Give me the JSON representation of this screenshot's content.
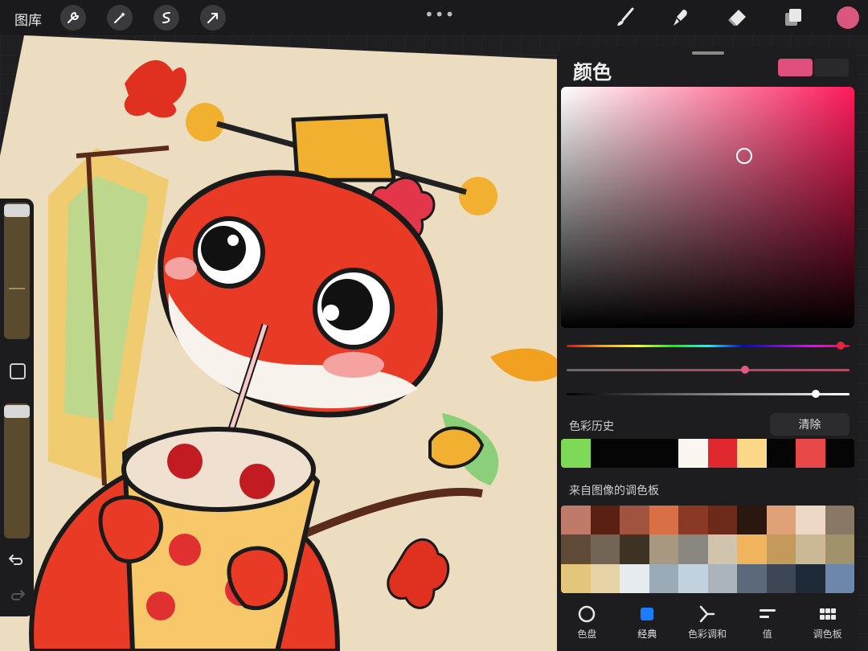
{
  "topbar": {
    "gallery_label": "图库",
    "tools_left": [
      "wrench-icon",
      "magic-wand-icon",
      "selection-icon",
      "transform-arrow-icon"
    ],
    "tools_right": [
      "brush-icon",
      "smudge-icon",
      "eraser-icon",
      "layers-icon"
    ],
    "active_color": "#d9577e"
  },
  "sidebar": {
    "size_slider_value": 0.95,
    "opacity_slider_value": 0.98,
    "modify_button": "square-icon",
    "undo": "undo-icon",
    "redo": "redo-icon"
  },
  "panel": {
    "title": "颜色",
    "current_color": "#e0507f",
    "previous_color": "#2a2a2c",
    "hue_bar_value": 0.97,
    "saturation_bar_value": 0.63,
    "brightness_bar_value": 0.88,
    "history_label": "色彩历史",
    "clear_label": "清除",
    "history_colors": [
      "#7ed957",
      "#050505",
      "#050505",
      "#050505",
      "#faf7f2",
      "#e0282e",
      "#fcd989",
      "#050505",
      "#e84848",
      "#050505"
    ],
    "image_palette_label": "来自图像的调色板",
    "image_palette": [
      "#c07a6a",
      "#5a2012",
      "#a0533f",
      "#d96f45",
      "#8a3a24",
      "#6e2a18",
      "#2a1710",
      "#e1a176",
      "#ecd8c4",
      "#8a7867",
      "#5e4a36",
      "#726556",
      "#3e3224",
      "#a89880",
      "#8a8680",
      "#d2c3ac",
      "#f0b55c",
      "#c49a5a",
      "#cbb996",
      "#a0926a",
      "#e3c67c",
      "#e6d4a6",
      "#e6ecee",
      "#9aaab6",
      "#c2d2de",
      "#aab4bc",
      "#5a6a7a",
      "#3c4654",
      "#1e2a38",
      "#6c86ac"
    ],
    "tabs": [
      {
        "label": "色盘",
        "icon": "disc-icon"
      },
      {
        "label": "经典",
        "icon": "classic-square-icon"
      },
      {
        "label": "色彩调和",
        "icon": "harmony-icon"
      },
      {
        "label": "值",
        "icon": "value-bars-icon"
      },
      {
        "label": "调色板",
        "icon": "palette-grid-icon"
      }
    ],
    "active_tab": 1
  }
}
